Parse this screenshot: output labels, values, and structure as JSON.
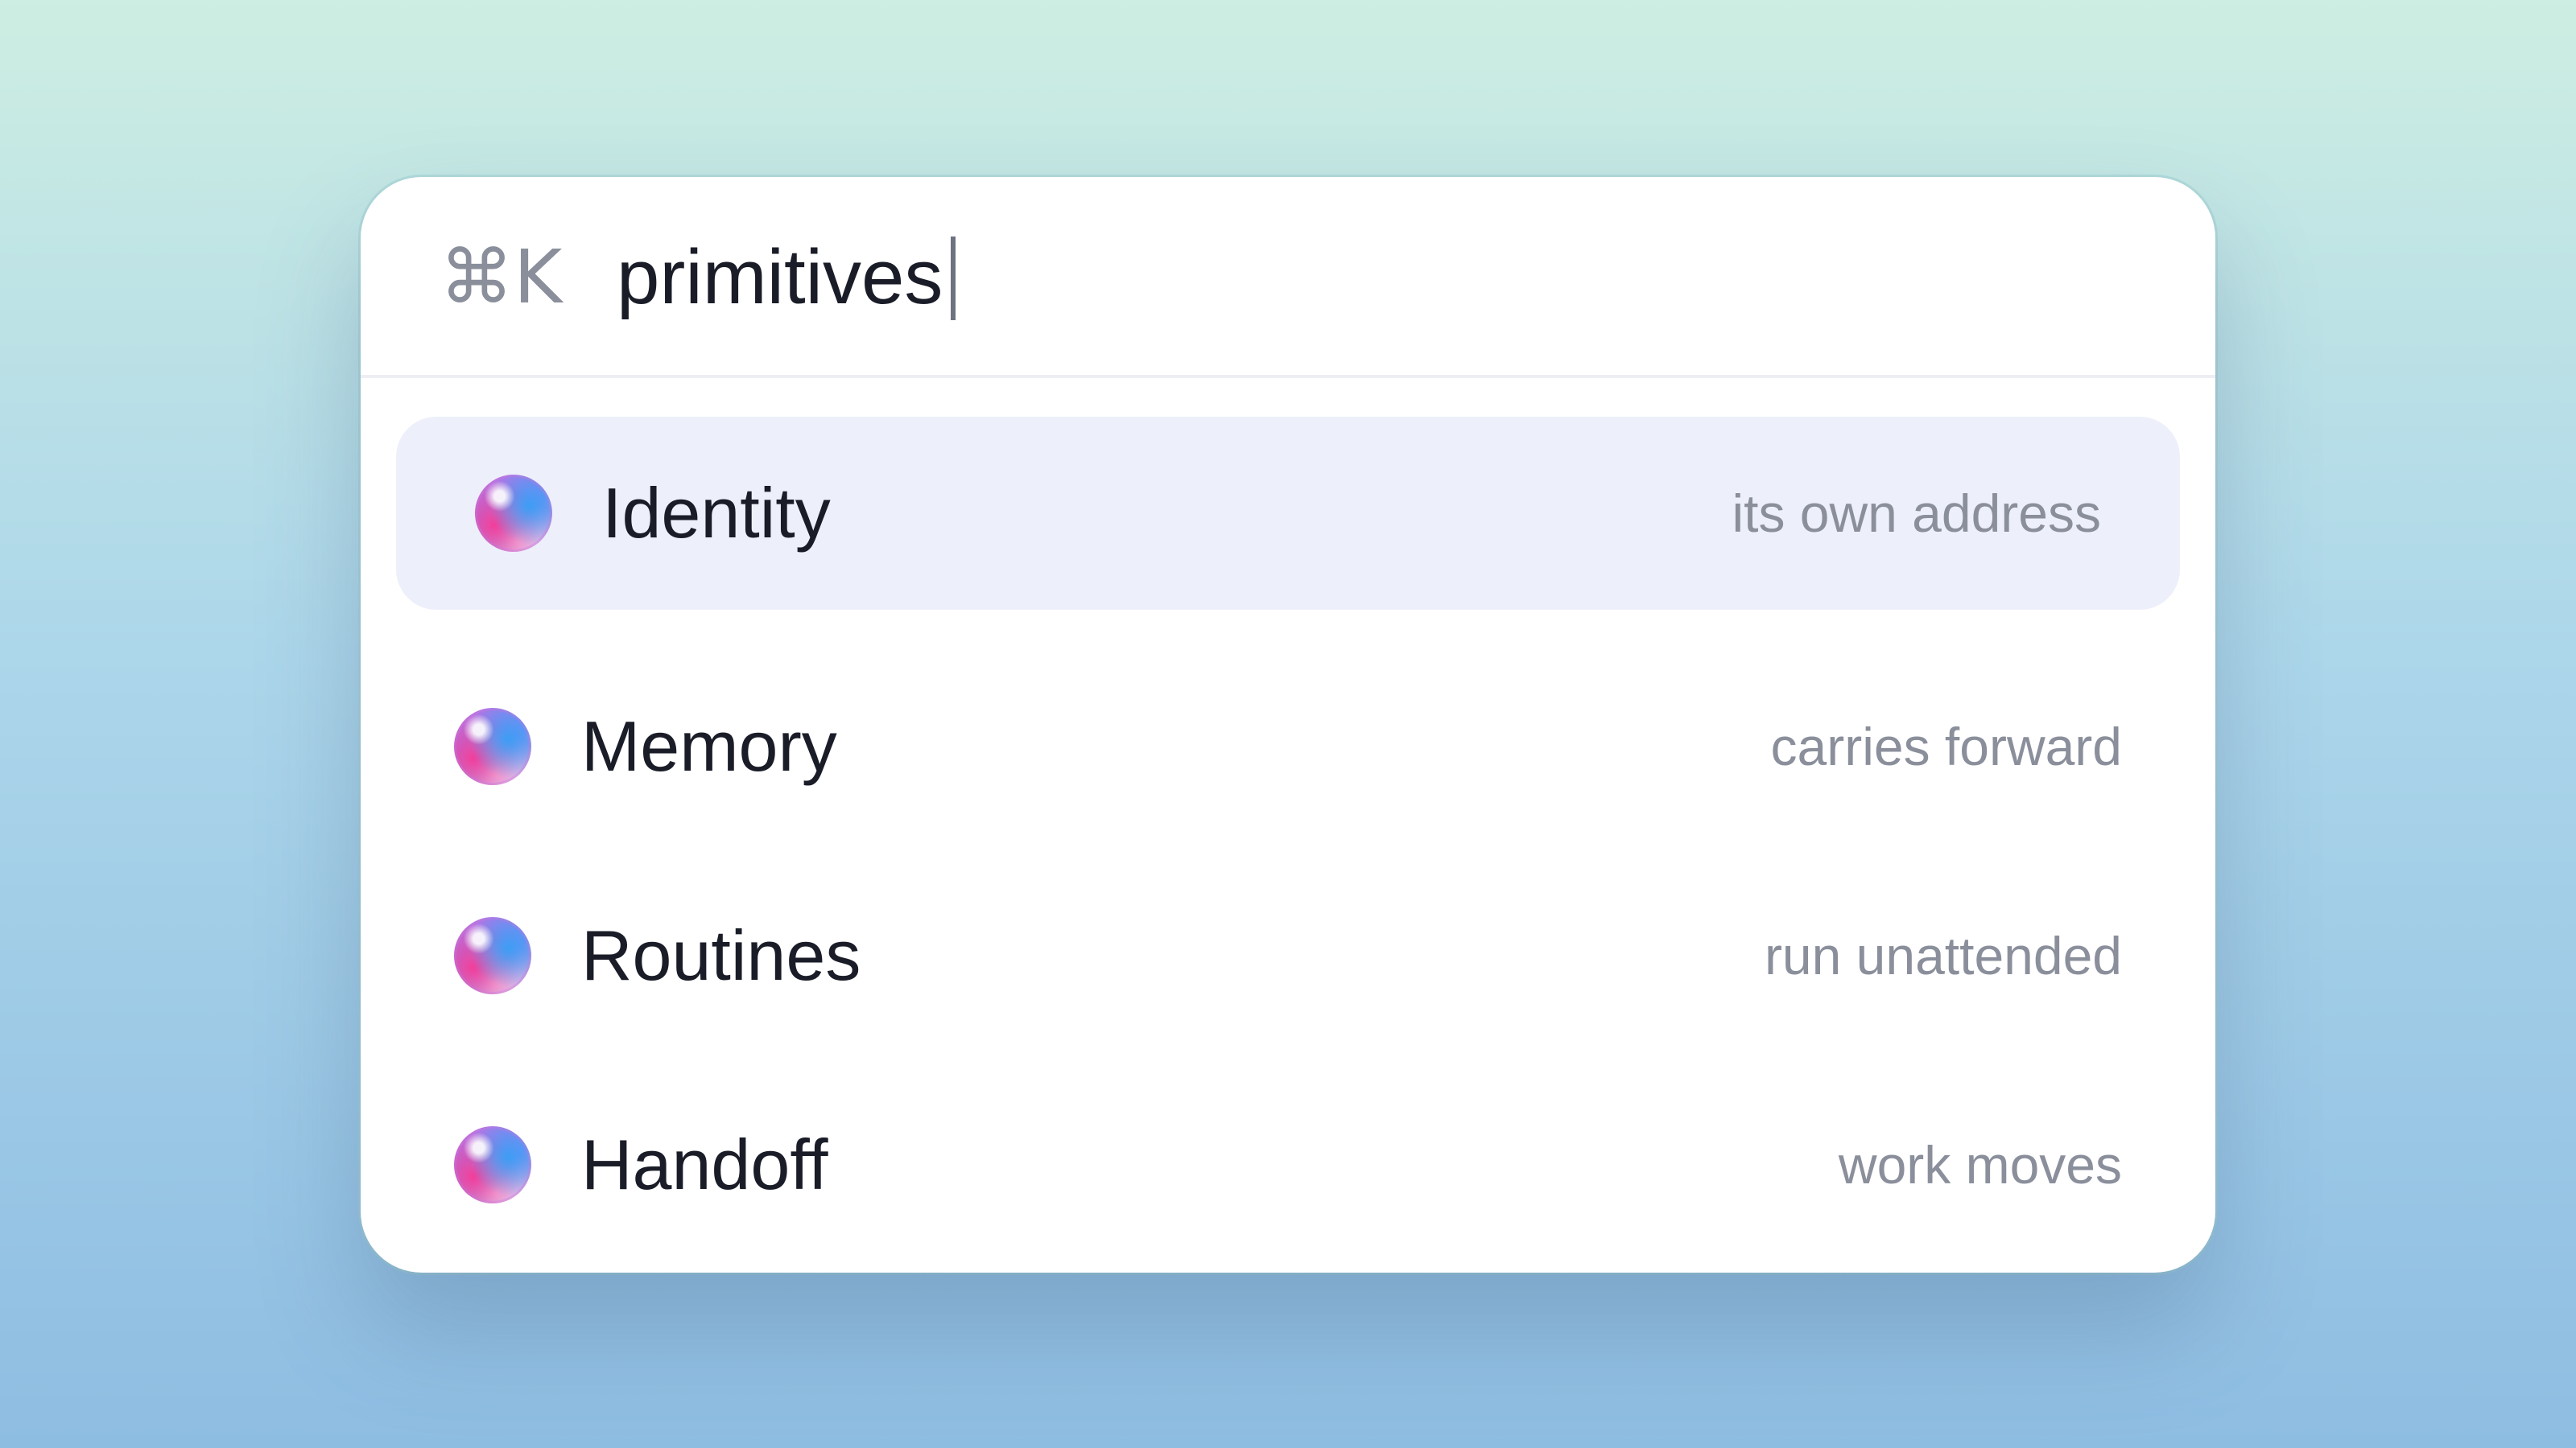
{
  "palette": {
    "shortcut": "⌘K",
    "query": "primitives"
  },
  "results": [
    {
      "label": "Identity",
      "hint": "its own address",
      "icon": "gradient-orb-icon",
      "selected": true
    },
    {
      "label": "Memory",
      "hint": "carries forward",
      "icon": "gradient-orb-icon",
      "selected": false
    },
    {
      "label": "Routines",
      "hint": "run unattended",
      "icon": "gradient-orb-icon",
      "selected": false
    },
    {
      "label": "Handoff",
      "hint": "work moves",
      "icon": "gradient-orb-icon",
      "selected": false
    }
  ],
  "colors": {
    "selected_bg": "#edf0fa",
    "text_primary": "#1a1d28",
    "text_secondary": "#8a8f9b"
  }
}
